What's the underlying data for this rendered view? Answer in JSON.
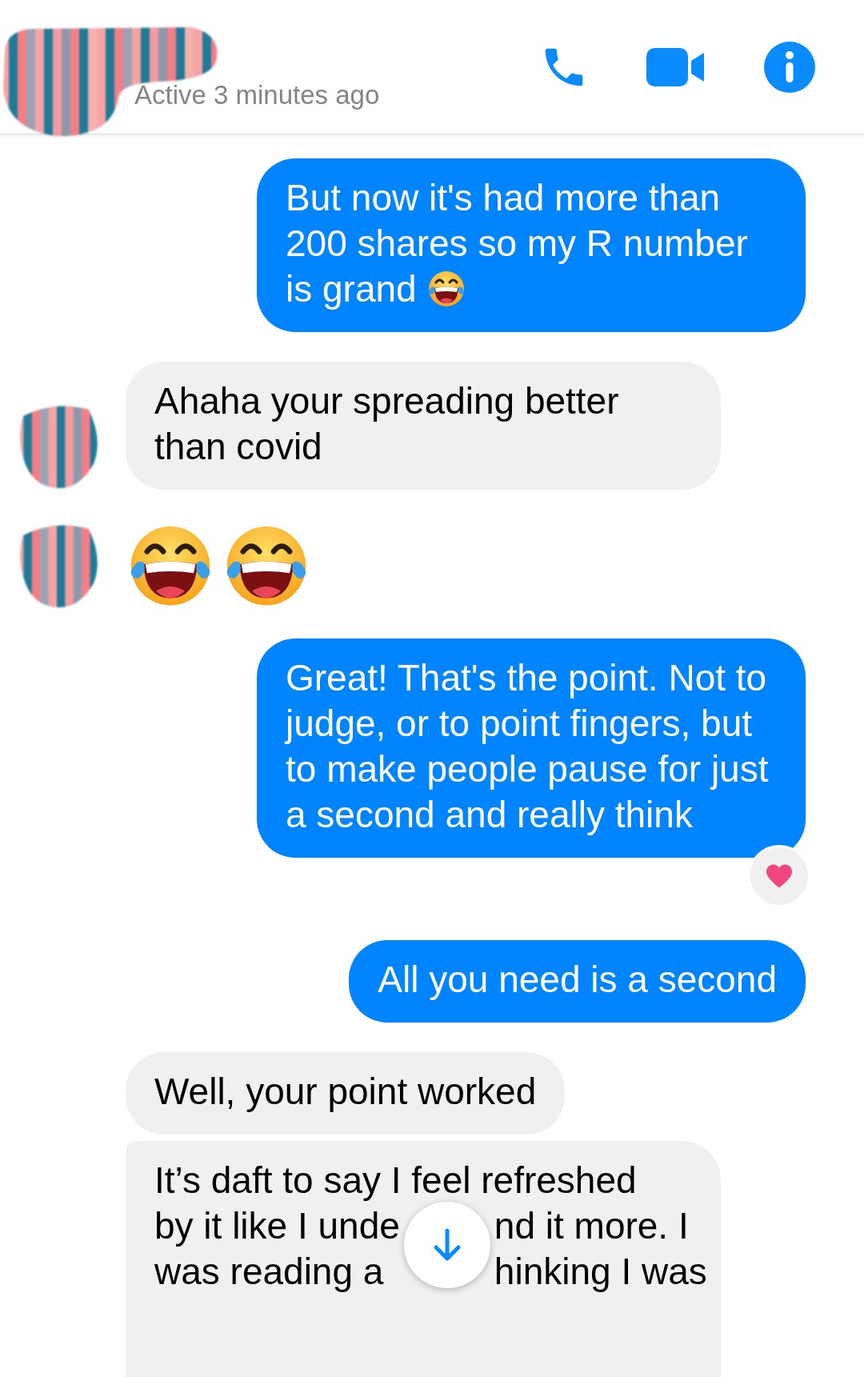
{
  "header": {
    "contact_redacted": true,
    "status": "Active 3 minutes ago",
    "actions": [
      {
        "kind": "call"
      },
      {
        "kind": "video"
      },
      {
        "kind": "info"
      }
    ]
  },
  "messages": [
    {
      "kind": "outgoing",
      "text": "But now it's had more than 200 shares so my R number is grand",
      "trailing_emoji": true
    },
    {
      "kind": "incoming",
      "avatar": true,
      "text": "Ahaha your spreading better than covid"
    },
    {
      "kind": "emoji",
      "avatar": true,
      "emojis": [
        {
          "kind": "laugh"
        },
        {
          "kind": "laugh"
        }
      ]
    },
    {
      "kind": "outgoing",
      "text": "Great! That's the point. Not to judge, or to point fingers, but to make people pause for just a second and really think",
      "reaction": {
        "kind": "heart"
      }
    },
    {
      "kind": "outgoing",
      "text": "All you need is a second"
    },
    {
      "kind": "incoming",
      "avatar": false,
      "text": "Well, your point worked"
    },
    {
      "kind": "incoming",
      "avatar": false,
      "lines": [
        [
          "It’s daft to say I feel refreshed"
        ],
        [
          "by it like I unde",
          "nd it more. I"
        ],
        [
          "was reading a",
          "hinking I was"
        ]
      ]
    }
  ],
  "scroll_down_button": true
}
